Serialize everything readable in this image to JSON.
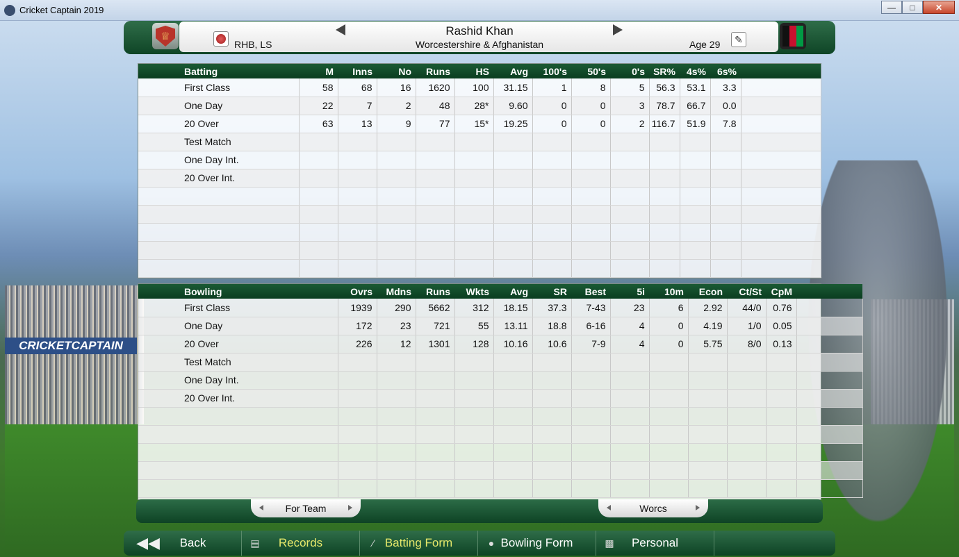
{
  "window": {
    "title": "Cricket Captain 2019",
    "min": "—",
    "max": "□",
    "close": "✕"
  },
  "header": {
    "style": "RHB, LS",
    "name": "Rashid Khan",
    "team": "Worcestershire & Afghanistan",
    "age": "Age 29",
    "edit_glyph": "✎"
  },
  "batting": {
    "columns": [
      "Batting",
      "M",
      "Inns",
      "No",
      "Runs",
      "HS",
      "Avg",
      "100's",
      "50's",
      "0's",
      "SR%",
      "4s%",
      "6s%"
    ],
    "rows": [
      [
        "First Class",
        "58",
        "68",
        "16",
        "1620",
        "100",
        "31.15",
        "1",
        "8",
        "5",
        "56.3",
        "53.1",
        "3.3"
      ],
      [
        "One Day",
        "22",
        "7",
        "2",
        "48",
        "28*",
        "9.60",
        "0",
        "0",
        "3",
        "78.7",
        "66.7",
        "0.0"
      ],
      [
        "20 Over",
        "63",
        "13",
        "9",
        "77",
        "15*",
        "19.25",
        "0",
        "0",
        "2",
        "116.7",
        "51.9",
        "7.8"
      ],
      [
        "Test Match",
        "",
        "",
        "",
        "",
        "",
        "",
        "",
        "",
        "",
        "",
        "",
        ""
      ],
      [
        "One Day Int.",
        "",
        "",
        "",
        "",
        "",
        "",
        "",
        "",
        "",
        "",
        "",
        ""
      ],
      [
        "20 Over Int.",
        "",
        "",
        "",
        "",
        "",
        "",
        "",
        "",
        "",
        "",
        "",
        ""
      ],
      [
        "",
        "",
        "",
        "",
        "",
        "",
        "",
        "",
        "",
        "",
        "",
        "",
        ""
      ],
      [
        "",
        "",
        "",
        "",
        "",
        "",
        "",
        "",
        "",
        "",
        "",
        "",
        ""
      ],
      [
        "",
        "",
        "",
        "",
        "",
        "",
        "",
        "",
        "",
        "",
        "",
        "",
        ""
      ],
      [
        "",
        "",
        "",
        "",
        "",
        "",
        "",
        "",
        "",
        "",
        "",
        "",
        ""
      ],
      [
        "",
        "",
        "",
        "",
        "",
        "",
        "",
        "",
        "",
        "",
        "",
        "",
        ""
      ]
    ]
  },
  "bowling": {
    "columns": [
      "Bowling",
      "Ovrs",
      "Mdns",
      "Runs",
      "Wkts",
      "Avg",
      "SR",
      "Best",
      "5i",
      "10m",
      "Econ",
      "Ct/St",
      "CpM"
    ],
    "rows": [
      [
        "First Class",
        "1939",
        "290",
        "5662",
        "312",
        "18.15",
        "37.3",
        "7-43",
        "23",
        "6",
        "2.92",
        "44/0",
        "0.76"
      ],
      [
        "One Day",
        "172",
        "23",
        "721",
        "55",
        "13.11",
        "18.8",
        "6-16",
        "4",
        "0",
        "4.19",
        "1/0",
        "0.05"
      ],
      [
        "20 Over",
        "226",
        "12",
        "1301",
        "128",
        "10.16",
        "10.6",
        "7-9",
        "4",
        "0",
        "5.75",
        "8/0",
        "0.13"
      ],
      [
        "Test Match",
        "",
        "",
        "",
        "",
        "",
        "",
        "",
        "",
        "",
        "",
        "",
        ""
      ],
      [
        "One Day Int.",
        "",
        "",
        "",
        "",
        "",
        "",
        "",
        "",
        "",
        "",
        "",
        ""
      ],
      [
        "20 Over Int.",
        "",
        "",
        "",
        "",
        "",
        "",
        "",
        "",
        "",
        "",
        "",
        ""
      ],
      [
        "",
        "",
        "",
        "",
        "",
        "",
        "",
        "",
        "",
        "",
        "",
        "",
        ""
      ],
      [
        "",
        "",
        "",
        "",
        "",
        "",
        "",
        "",
        "",
        "",
        "",
        "",
        ""
      ],
      [
        "",
        "",
        "",
        "",
        "",
        "",
        "",
        "",
        "",
        "",
        "",
        "",
        ""
      ],
      [
        "",
        "",
        "",
        "",
        "",
        "",
        "",
        "",
        "",
        "",
        "",
        "",
        ""
      ],
      [
        "",
        "",
        "",
        "",
        "",
        "",
        "",
        "",
        "",
        "",
        "",
        "",
        ""
      ]
    ]
  },
  "team_selector": {
    "left": "For Team",
    "right": "Worcs"
  },
  "nav": {
    "back": "Back",
    "records": "Records",
    "batting_form": "Batting Form",
    "bowling_form": "Bowling Form",
    "personal": "Personal",
    "back_glyph": "◀◀"
  },
  "background": {
    "banner": "CRICKETCAPTAIN"
  },
  "colors": {
    "header_green": "#0f4526",
    "active_nav": "#e6e86a"
  }
}
